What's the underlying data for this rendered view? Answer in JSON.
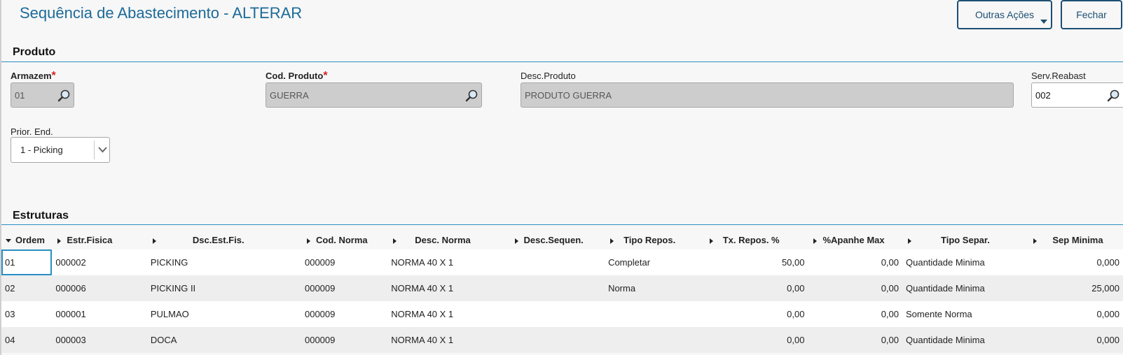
{
  "header": {
    "title": "Sequência de Abastecimento - ALTERAR",
    "other_actions_label": "Outras Ações",
    "close_label": "Fechar"
  },
  "produto": {
    "section_title": "Produto",
    "armazem": {
      "label": "Armazem",
      "value": "01"
    },
    "cod_produto": {
      "label": "Cod. Produto",
      "value": "GUERRA"
    },
    "desc_produto": {
      "label": "Desc.Produto",
      "value": "PRODUTO GUERRA"
    },
    "serv_reabast": {
      "label": "Serv.Reabast",
      "value": "002"
    },
    "prior_end": {
      "label": "Prior. End.",
      "selected": "1 - Picking"
    },
    "required_mark": "*"
  },
  "estruturas": {
    "section_title": "Estruturas",
    "columns": [
      "Ordem",
      "Estr.Fisica",
      "Dsc.Est.Fis.",
      "Cod. Norma",
      "Desc. Norma",
      "Desc.Sequen.",
      "Tipo Repos.",
      "Tx. Repos. %",
      "%Apanhe Max",
      "Tipo Separ.",
      "Sep Minima"
    ],
    "rows": [
      [
        "01",
        "000002",
        "PICKING",
        "000009",
        "NORMA 40 X 1",
        "",
        "Completar",
        "50,00",
        "0,00",
        "Quantidade Minima",
        "0,000"
      ],
      [
        "02",
        "000006",
        "PICKING II",
        "000009",
        "NORMA 40 X 1",
        "",
        "Norma",
        "0,00",
        "0,00",
        "Quantidade Minima",
        "25,000"
      ],
      [
        "03",
        "000001",
        "PULMAO",
        "000009",
        "NORMA 40 X 1",
        "",
        "",
        "0,00",
        "0,00",
        "Somente Norma",
        "0,000"
      ],
      [
        "04",
        "000003",
        "DOCA",
        "000009",
        "NORMA 40 X 1",
        "",
        "",
        "0,00",
        "0,00",
        "Quantidade Minima",
        "0,000"
      ]
    ]
  },
  "colors": {
    "accent": "#2a8fc4",
    "title": "#1c6a98",
    "button": "#1c4f74",
    "required": "#d32020"
  }
}
